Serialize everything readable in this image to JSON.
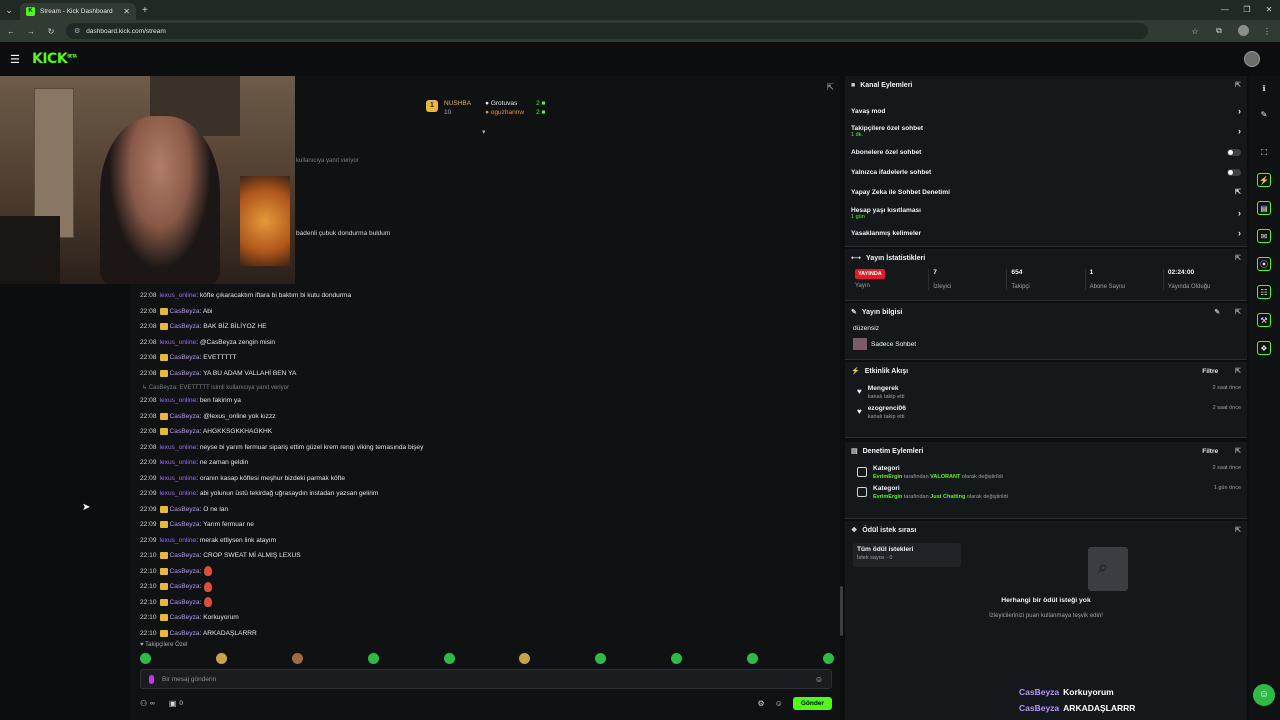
{
  "browser": {
    "tab_title": "Stream - Kick Dashboard",
    "url": "dashboard.kick.com/stream"
  },
  "app": {
    "logo": "KICK",
    "logo_mark": "BETA"
  },
  "stream_overlay": {
    "leaderboard": {
      "rank": "1",
      "first_name": "NUSHBA",
      "first_count": "10",
      "second_name": "Grotuvas",
      "second_count": "2",
      "third_name": "oguzhannw",
      "third_count": "2"
    },
    "reply_hint": "kullanıcıya yanıt veriyor",
    "partial_msg": "badenli çubuk dondurma buldum"
  },
  "chat": {
    "messages": [
      {
        "time": "22:08",
        "user": "lexus_online",
        "crown": false,
        "text": ": köfte çıkaracaktım iftara bi baktım bi kutu dondurma"
      },
      {
        "time": "22:08",
        "user": "CasBeyza",
        "crown": true,
        "text": ": Abi"
      },
      {
        "time": "22:08",
        "user": "CasBeyza",
        "crown": true,
        "text": ": BAK BİZ BİLİYOZ HE"
      },
      {
        "time": "22:08",
        "user": "lexus_online",
        "crown": false,
        "text": ": @CasBeyza zengin misin"
      },
      {
        "time": "22:08",
        "user": "CasBeyza",
        "crown": true,
        "text": ": EVETTTTT"
      },
      {
        "time": "22:08",
        "user": "CasBeyza",
        "crown": true,
        "text": ": YA BU ADAM VALLAHİ BEN YA"
      }
    ],
    "reply_line": "↳ CasBeyza: EVETTTTT isimli kullanıcıya yanıt veriyor",
    "messages2": [
      {
        "time": "22:08",
        "user": "lexus_online",
        "crown": false,
        "text": ": ben fakirim ya"
      },
      {
        "time": "22:08",
        "user": "CasBeyza",
        "crown": true,
        "text": ": @lexus_online yok kızzz"
      },
      {
        "time": "22:08",
        "user": "CasBeyza",
        "crown": true,
        "text": ": AHGKKSGKKHAGKHK"
      },
      {
        "time": "22:08",
        "user": "lexus_online",
        "crown": false,
        "text": ": neyse bi yarım fermuar sipariş ettim güzel krem rengi viking temasında bişey"
      },
      {
        "time": "22:09",
        "user": "lexus_online",
        "crown": false,
        "text": ": ne zaman geldin"
      },
      {
        "time": "22:09",
        "user": "lexus_online",
        "crown": false,
        "text": ": oranın kasap köftesi meşhur bizdeki parmak köfte"
      },
      {
        "time": "22:09",
        "user": "lexus_online",
        "crown": false,
        "text": ": abi yolunun üstü tekirdağ uğrasaydın instadan yazsan gelirim"
      },
      {
        "time": "22:09",
        "user": "CasBeyza",
        "crown": true,
        "text": ": O ne lan"
      },
      {
        "time": "22:09",
        "user": "CasBeyza",
        "crown": true,
        "text": ": Yarım fermuar ne"
      },
      {
        "time": "22:09",
        "user": "lexus_online",
        "crown": false,
        "text": ": merak ettiysen link atayım"
      },
      {
        "time": "22:10",
        "user": "CasBeyza",
        "crown": true,
        "text": ": CROP SWEAT Mİ ALMIŞ LEXUS"
      },
      {
        "time": "22:10",
        "user": "CasBeyza",
        "crown": true,
        "text": ":",
        "emote": true
      },
      {
        "time": "22:10",
        "user": "CasBeyza",
        "crown": true,
        "text": ":",
        "emote": true
      },
      {
        "time": "22:10",
        "user": "CasBeyza",
        "crown": true,
        "text": ":",
        "emote": true
      },
      {
        "time": "22:10",
        "user": "CasBeyza",
        "crown": true,
        "text": ": Korkuyorum"
      },
      {
        "time": "22:10",
        "user": "CasBeyza",
        "crown": true,
        "text": ": ARKADAŞLARRR"
      }
    ],
    "followers_only": "♥ Takipçilere Özel",
    "input_placeholder": "Bir mesaj gönderin",
    "infinity_label": "∞",
    "count_label": "0",
    "send_label": "Gönder"
  },
  "panels": {
    "kanal": {
      "title": "Kanal Eylemleri",
      "slow_mode": "Yavaş mod",
      "followers_chat": "Takipçilere özel sohbet",
      "followers_chat_sub": "1 dk.",
      "subs_chat": "Abonelere özel sohbet",
      "emote_chat": "Yalnızca ifadelerle sohbet",
      "ai_mod": "Yapay Zeka ile Sohbet Denetimi",
      "age_limit": "Hesap yaşı kısıtlaması",
      "age_limit_sub": "1 gün",
      "banned_words": "Yasaklanmış kelimeler"
    },
    "stats": {
      "title": "Yayın İstatistikleri",
      "live": "YAYINDA",
      "live_label": "Yayın",
      "viewers": "7",
      "viewers_label": "İzleyici",
      "followers": "654",
      "followers_label": "Takipçi",
      "subs": "1",
      "subs_label": "Abone Sayısı",
      "duration": "02:24:00",
      "duration_label": "Yayında Olduğu"
    },
    "info": {
      "title": "Yayın bilgisi",
      "stream_title": "düzensiz",
      "category": "Sadece Sohbet"
    },
    "activity": {
      "title": "Etkinlik Akışı",
      "filter": "Filtre",
      "events": [
        {
          "name": "Mengerek",
          "desc": "kanalı takip etti",
          "time": "2 saat önce"
        },
        {
          "name": "ezogrenci06",
          "desc": "kanalı takip etti",
          "time": "2 saat önce"
        }
      ]
    },
    "moderation": {
      "title": "Denetim Eylemleri",
      "filter": "Filtre",
      "events": [
        {
          "name": "Kategori",
          "who": "EvrimErgin",
          "mid": " tarafından ",
          "val": "VALORANT",
          "end": " olarak değiştirildi",
          "time": "2 saat önce"
        },
        {
          "name": "Kategori",
          "who": "EvrimErgin",
          "mid": " tarafından ",
          "val": "Just Chatting",
          "end": " olarak değiştirildi",
          "time": "1 gün önce"
        }
      ]
    },
    "rewards": {
      "title": "Ödül istek sırası",
      "tab_title": "Tüm ödül istekleri",
      "tab_count": "İstek sayısı - 0",
      "empty_title": "Herhangi bir ödül isteği yok",
      "empty_hint": "İzleyicilerinizi puan kullanmaya teşvik edin!"
    }
  },
  "overlay_chat": [
    {
      "user": "CasBeyza",
      "text": "Korkuyorum"
    },
    {
      "user": "CasBeyza",
      "text": "ARKADAŞLARRR"
    }
  ],
  "colors": {
    "brand": "#53fc18",
    "live": "#e5192b",
    "username": "#b494ff"
  }
}
